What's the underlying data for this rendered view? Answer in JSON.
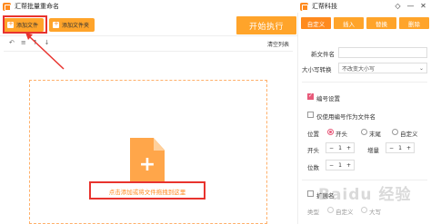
{
  "titlebar": {
    "left_title": "汇帮批量重命名",
    "right_title": "汇帮科技",
    "minimize": "—",
    "close": "✕",
    "diamond": "◇"
  },
  "toolbar": {
    "add_file": "添加文件",
    "add_folder": "添加文件夹",
    "start": "开始执行"
  },
  "subbar": {
    "icons": [
      "↶",
      "≡",
      "↑",
      "↓"
    ],
    "clear_list": "清空列表"
  },
  "drop_zone": {
    "hint": "点击添加或将文件拖拽到这里",
    "plus": "+"
  },
  "tabs": [
    {
      "label": "自定义",
      "active": true
    },
    {
      "label": "插入",
      "active": false
    },
    {
      "label": "替换",
      "active": false
    },
    {
      "label": "删除",
      "active": false
    }
  ],
  "form": {
    "new_name_label": "新文件名",
    "new_name_value": "",
    "case_label": "大小写转换",
    "case_value": "不改变大小写",
    "numbering_label": "编号设置",
    "numbering_checked": true,
    "only_number_label": "仅使用编号作为文件名",
    "only_number_checked": false,
    "position_label": "位置",
    "position_options": [
      "开头",
      "末尾",
      "自定义"
    ],
    "position_selected": "开头",
    "start_label": "开头",
    "start_value": "1",
    "increment_label": "增量",
    "increment_value": "1",
    "digits_label": "位数",
    "digits_value": "1",
    "extension_label": "扩展名",
    "extension_checked": false,
    "type_label": "类型",
    "type_options": [
      "自定义",
      "大写"
    ]
  },
  "watermark": "Baidu 经验",
  "colors": {
    "accent": "#ffa42a",
    "accent_dark": "#ff8a1e",
    "highlight_red": "#e8332e",
    "check_pink": "#e85a7a"
  }
}
